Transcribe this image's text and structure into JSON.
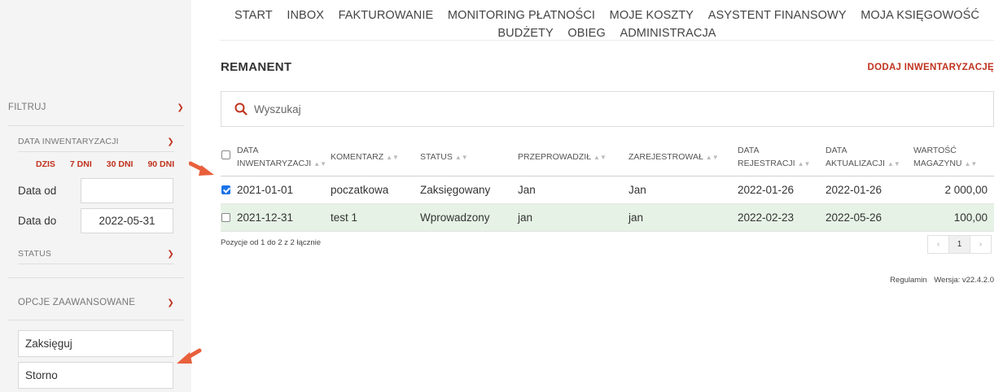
{
  "nav": {
    "row1": [
      "START",
      "INBOX",
      "FAKTUROWANIE",
      "MONITORING PŁATNOŚCI",
      "MOJE KOSZTY",
      "ASYSTENT FINANSOWY",
      "MOJA KSIĘGOWOŚĆ"
    ],
    "row2": [
      "BUDŻETY",
      "OBIEG",
      "ADMINISTRACJA"
    ]
  },
  "sidebar": {
    "filter_label": "FILTRUJ",
    "date_section_label": "DATA INWENTARYZACJI",
    "quick": [
      "DZIS",
      "7 DNI",
      "30 DNI",
      "90 DNI"
    ],
    "date_from_label": "Data od",
    "date_from_value": "",
    "date_to_label": "Data do",
    "date_to_value": "2022-05-31",
    "status_label": "STATUS",
    "advanced_label": "OPCJE ZAAWANSOWANE",
    "action_book": "Zaksięguj",
    "action_storno": "Storno"
  },
  "page": {
    "title": "REMANENT",
    "add_button": "DODAJ INWENTARYZACJĘ",
    "search_placeholder": "Wyszukaj"
  },
  "table": {
    "headers": {
      "date_inv_1": "DATA",
      "date_inv_2": "INWENTARYZACJI",
      "comment": "KOMENTARZ",
      "status": "STATUS",
      "conducted": "PRZEPROWADZIŁ",
      "registered": "ZAREJESTROWAŁ",
      "reg_date_1": "DATA",
      "reg_date_2": "REJESTRACJI",
      "upd_date_1": "DATA",
      "upd_date_2": "AKTUALIZACJI",
      "value_1": "WARTOŚĆ",
      "value_2": "MAGAZYNU"
    },
    "rows": [
      {
        "date": "2021-01-01",
        "comment": "poczatkowa",
        "status": "Zaksięgowany",
        "conducted": "Jan",
        "registered": "Jan",
        "reg_date": "2022-01-26",
        "upd_date": "2022-01-26",
        "value": "2 000,00",
        "checked": true
      },
      {
        "date": "2021-12-31",
        "comment": "test 1",
        "status": "Wprowadzony",
        "conducted": "jan",
        "registered": "jan",
        "reg_date": "2022-02-23",
        "upd_date": "2022-05-26",
        "value": "100,00",
        "checked": false
      }
    ],
    "summary": "Pozycje od 1 do 2 z 2 łącznie",
    "pager": {
      "prev": "‹",
      "current": "1",
      "next": "›"
    }
  },
  "footer": {
    "terms": "Regulamin",
    "version": "Wersja: v22.4.2.0"
  },
  "colors": {
    "accent": "#c0321e",
    "arrow": "#e8603c",
    "row_highlight": "#e6f2e6",
    "sidebar_bg": "#f4f4f4"
  }
}
